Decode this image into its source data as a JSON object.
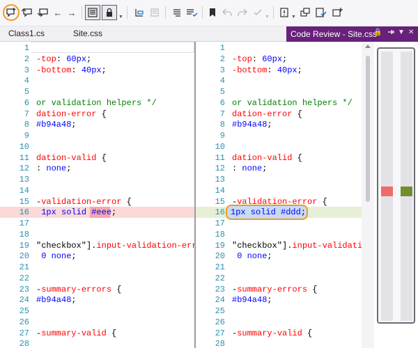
{
  "toolbar": {
    "buttons": [
      {
        "name": "add-comment-icon"
      },
      {
        "name": "previous-comment-icon"
      },
      {
        "name": "next-comment-icon"
      },
      {
        "name": "back-arrow-icon",
        "glyph": "←"
      },
      {
        "name": "forward-arrow-icon",
        "glyph": "→"
      },
      {
        "name": "side-by-side-icon"
      },
      {
        "name": "lock-scroll-icon"
      },
      {
        "name": "toolbar-overflow-icon"
      },
      {
        "name": "previous-change-icon"
      },
      {
        "name": "next-change-disabled-icon"
      },
      {
        "name": "show-whitespace-icon"
      },
      {
        "name": "ignore-whitespace-icon"
      },
      {
        "name": "bookmark-icon"
      },
      {
        "name": "reply-disabled-icon"
      },
      {
        "name": "forward-disabled-icon"
      },
      {
        "name": "accept-disabled-icon"
      },
      {
        "name": "issue-icon"
      },
      {
        "name": "copy-window-icon"
      },
      {
        "name": "review-check-icon"
      },
      {
        "name": "new-window-icon"
      }
    ]
  },
  "tabs": {
    "items": [
      "Class1.cs",
      "Site.css"
    ],
    "active": "Code Review - Site.css"
  },
  "left_pane": {
    "lines": [
      {
        "n": "1",
        "t": ""
      },
      {
        "n": "2",
        "t": "-top: 60px;",
        "k": "-top",
        "v": "60px"
      },
      {
        "n": "3",
        "t": "-bottom: 40px;",
        "k": "-bottom",
        "v": "40px"
      },
      {
        "n": "4",
        "t": ""
      },
      {
        "n": "5",
        "t": ""
      },
      {
        "n": "6",
        "t": "or validation helpers */",
        "c": true
      },
      {
        "n": "7",
        "t": "dation-error {"
      },
      {
        "n": "8",
        "t": "#b94a48;",
        "v": "#b94a48"
      },
      {
        "n": "9",
        "t": ""
      },
      {
        "n": "10",
        "t": ""
      },
      {
        "n": "11",
        "t": "dation-valid {"
      },
      {
        "n": "12",
        "t": ": none;",
        "v": "none"
      },
      {
        "n": "13",
        "t": ""
      },
      {
        "n": "14",
        "t": ""
      },
      {
        "n": "15",
        "t": "-validation-error {"
      },
      {
        "n": "16",
        "t": " 1px solid #eee;",
        "v": "1px solid #eee"
      },
      {
        "n": "17",
        "t": ""
      },
      {
        "n": "18",
        "t": ""
      },
      {
        "n": "19",
        "t": "\"checkbox\"].input-validation-erro"
      },
      {
        "n": "20",
        "t": " 0 none;",
        "v": "0 none"
      },
      {
        "n": "21",
        "t": ""
      },
      {
        "n": "22",
        "t": ""
      },
      {
        "n": "23",
        "t": "-summary-errors {"
      },
      {
        "n": "24",
        "t": "#b94a48;",
        "v": "#b94a48"
      },
      {
        "n": "25",
        "t": ""
      },
      {
        "n": "26",
        "t": ""
      },
      {
        "n": "27",
        "t": "-summary-valid {"
      },
      {
        "n": "28",
        "t": ""
      }
    ]
  },
  "right_pane": {
    "lines": [
      {
        "n": "1",
        "t": ""
      },
      {
        "n": "2",
        "t": "-top: 60px;",
        "k": "-top",
        "v": "60px"
      },
      {
        "n": "3",
        "t": "-bottom: 40px;",
        "k": "-bottom",
        "v": "40px"
      },
      {
        "n": "4",
        "t": ""
      },
      {
        "n": "5",
        "t": ""
      },
      {
        "n": "6",
        "t": "or validation helpers */",
        "c": true
      },
      {
        "n": "7",
        "t": "dation-error {"
      },
      {
        "n": "8",
        "t": "#b94a48;",
        "v": "#b94a48"
      },
      {
        "n": "9",
        "t": ""
      },
      {
        "n": "10",
        "t": ""
      },
      {
        "n": "11",
        "t": "dation-valid {"
      },
      {
        "n": "12",
        "t": ": none;",
        "v": "none"
      },
      {
        "n": "13",
        "t": ""
      },
      {
        "n": "14",
        "t": ""
      },
      {
        "n": "15",
        "t": "-validation-error {"
      },
      {
        "n": "16",
        "t": "1px solid #ddd;",
        "v": "1px solid #ddd"
      },
      {
        "n": "17",
        "t": ""
      },
      {
        "n": "18",
        "t": ""
      },
      {
        "n": "19",
        "t": "\"checkbox\"].input-validation"
      },
      {
        "n": "20",
        "t": " 0 none;",
        "v": "0 none"
      },
      {
        "n": "21",
        "t": ""
      },
      {
        "n": "22",
        "t": ""
      },
      {
        "n": "23",
        "t": "-summary-errors {"
      },
      {
        "n": "24",
        "t": "#b94a48;",
        "v": "#b94a48"
      },
      {
        "n": "25",
        "t": ""
      },
      {
        "n": "26",
        "t": ""
      },
      {
        "n": "27",
        "t": "-summary-valid {"
      },
      {
        "n": "28",
        "t": ""
      }
    ]
  },
  "colors": {
    "accent_tab": "#68217a",
    "deleted_band": "#fbd9d9",
    "deleted_word": "#f6a8a8",
    "added_band": "#e7efd7",
    "highlight_ring": "#f29a1f",
    "overview_deleted": "#f06a6a",
    "overview_added": "#6f8f2e"
  }
}
